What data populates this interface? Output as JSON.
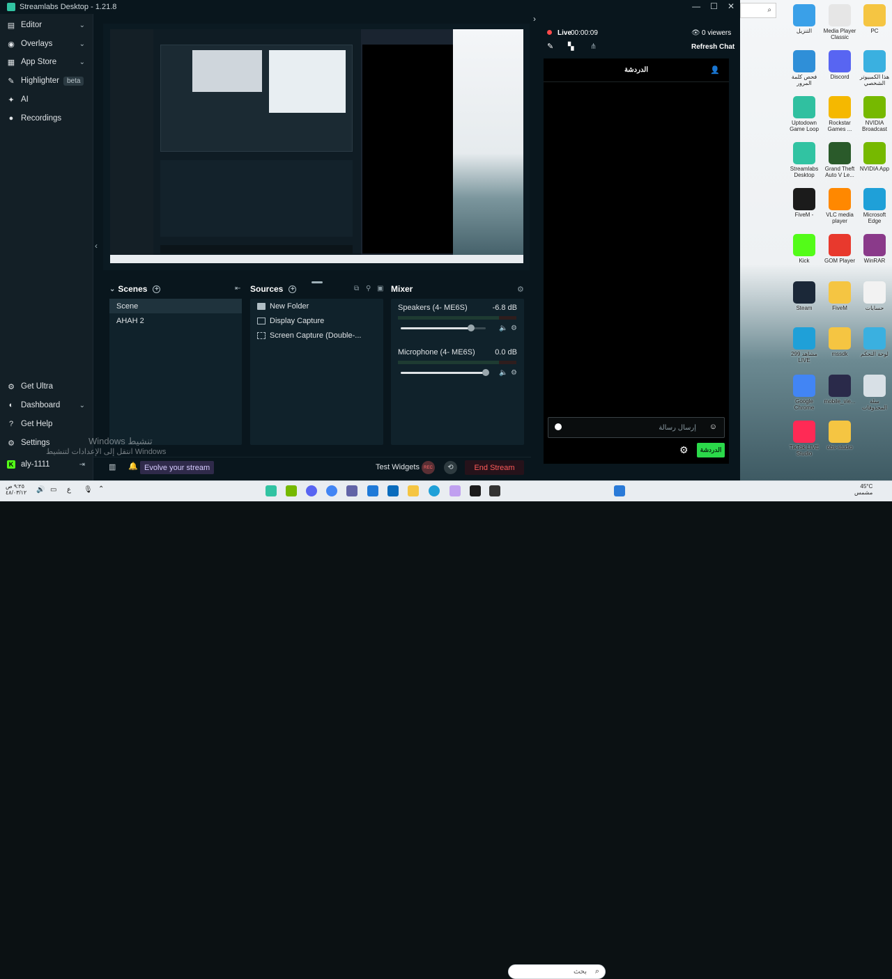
{
  "window": {
    "title": "Streamlabs Desktop - 1.21.8",
    "controls": [
      "—",
      "☐",
      "✕"
    ]
  },
  "sidebar": {
    "items": [
      {
        "label": "Editor",
        "icon": "editor-icon",
        "chevron": true
      },
      {
        "label": "Overlays",
        "icon": "overlays-icon",
        "chevron": true
      },
      {
        "label": "App Store",
        "icon": "app-store-icon",
        "chevron": true
      },
      {
        "label": "Highlighter",
        "icon": "highlighter-icon",
        "badge": "beta"
      },
      {
        "label": "AI",
        "icon": "ai-icon"
      },
      {
        "label": "Recordings",
        "icon": "recordings-icon"
      }
    ],
    "bottom_items": [
      {
        "label": "Get Ultra",
        "icon": "ultra-icon"
      },
      {
        "label": "Dashboard",
        "icon": "dashboard-icon",
        "chevron": true
      },
      {
        "label": "Get Help",
        "icon": "help-icon"
      },
      {
        "label": "Settings",
        "icon": "settings-icon"
      }
    ],
    "user": {
      "name": "aly-1111"
    }
  },
  "scenes": {
    "title": "Scenes",
    "items": [
      "Scene",
      "AHAH 2"
    ],
    "selected": 0
  },
  "sources": {
    "title": "Sources",
    "items": [
      {
        "label": "New Folder",
        "icon": "folder-icon"
      },
      {
        "label": "Display Capture",
        "icon": "monitor-icon"
      },
      {
        "label": "Screen Capture (Double-...",
        "icon": "screen-capture-icon"
      }
    ]
  },
  "mixer": {
    "title": "Mixer",
    "channels": [
      {
        "name": "Speakers (4- ME6S)",
        "db": "-6.8 dB",
        "level": 0.83
      },
      {
        "name": "Microphone (4- ME6S)",
        "db": "0.0 dB",
        "level": 1.0
      }
    ]
  },
  "bottom_bar": {
    "evolve": "Evolve your stream",
    "test_widgets": "Test Widgets",
    "rec": "REC",
    "end_stream": "End Stream"
  },
  "stream": {
    "live_label": "Live",
    "timer": "00:00:09",
    "viewers": "0 viewers",
    "refresh_chat": "Refresh Chat",
    "live_color": "#ff4a4a"
  },
  "chat": {
    "header": "الدردشة",
    "placeholder": "إرسال رسالة",
    "send_label": "الدردشة"
  },
  "watermark": {
    "line1": "Windows تنشيط",
    "line2": "انتقل إلى الإعدادات لتنشيط Windows"
  },
  "desktop_icons": [
    {
      "label": "التنزيل",
      "color": "#3aa0e8"
    },
    {
      "label": "Media Player Classic",
      "color": "#e6e6e6"
    },
    {
      "label": "PC",
      "color": "#f5c542"
    },
    {
      "label": "فحص كلمة المرور",
      "color": "#2f8fd8"
    },
    {
      "label": "Discord",
      "color": "#5865f2"
    },
    {
      "label": "هذا الكمبيوتر الشخصي",
      "color": "#3ab0e0"
    },
    {
      "label": "Uptodown Game Loop",
      "color": "#30c0a0"
    },
    {
      "label": "Rockstar Games ...",
      "color": "#f5b800"
    },
    {
      "label": "NVIDIA Broadcast",
      "color": "#76b900"
    },
    {
      "label": "Streamlabs Desktop",
      "color": "#31c3a2"
    },
    {
      "label": "Grand Theft Auto V Le...",
      "color": "#2a5a2a"
    },
    {
      "label": "NVIDIA App",
      "color": "#76b900"
    },
    {
      "label": "FiveM -",
      "color": "#1b1b1b"
    },
    {
      "label": "VLC media player",
      "color": "#ff8800"
    },
    {
      "label": "Microsoft Edge",
      "color": "#1fa0d8"
    },
    {
      "label": "Kick",
      "color": "#53fc18"
    },
    {
      "label": "GOM Player",
      "color": "#e8392d"
    },
    {
      "label": "WinRAR",
      "color": "#8a3a8a"
    },
    {
      "label": "Steam",
      "color": "#1b2838"
    },
    {
      "label": "FiveM",
      "color": "#f5c542"
    },
    {
      "label": "حسابات",
      "color": "#f2f2f2"
    },
    {
      "label": "299 مشاهد LIVE",
      "color": "#1fa0d8"
    },
    {
      "label": "mssdk",
      "color": "#f5c542"
    },
    {
      "label": "لوحة التحكم",
      "color": "#3ab0e0"
    },
    {
      "label": "Google Chrome",
      "color": "#4285f4"
    },
    {
      "label": "mobile_vie...",
      "color": "#2a2a4a"
    },
    {
      "label": "سلة المحذوفات",
      "color": "#d8e0e6"
    },
    {
      "label": "TikTok LIVE Studio",
      "color": "#ff2a55"
    },
    {
      "label": "obs-studio",
      "color": "#f5c542"
    }
  ],
  "taskbar": {
    "search_placeholder": "بحث",
    "weather_temp": "45°C",
    "weather_desc": "مشمس",
    "time": "٩:٢٥ ص",
    "date": "٤٨/٠٣/١٢",
    "lang": "ع"
  }
}
